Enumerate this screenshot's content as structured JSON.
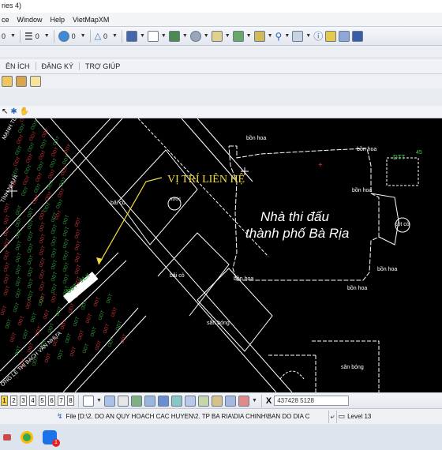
{
  "window": {
    "title_fragment": "ries 4)"
  },
  "menu": {
    "items": [
      "ce",
      "Window",
      "Help",
      "VietMapXM"
    ]
  },
  "toolbar1": {
    "counters": [
      "0",
      "0",
      "0",
      "0"
    ]
  },
  "tabs": {
    "items": [
      "ÊN ÍCH",
      "ĐĂNG KÝ",
      "TRỢ GIÚP"
    ]
  },
  "map": {
    "callout_text": "VỊ TRÍ LIÊN HỆ",
    "building_name_line1": "Nhà thi đấu",
    "building_name_line2": "thành phố Bà Rịa",
    "labels": {
      "bon_hoa": "bồn hoa",
      "bai_co": "bãi cỏ",
      "san_bong": "sân bóng",
      "cot_co": "cột cờ",
      "nuoc": "nước",
      "dtt": "DTT",
      "dtt_num": "45",
      "highlight_lot": "ODT - 91.X"
    },
    "streets": {
      "s1": "MẠNH TƯỜNG NHỰA",
      "s2": "TÍNH NHỰA",
      "s3": "ỜNG LÊ THỊ BẠCH VÂN NHỰA"
    },
    "lot_label": "ODT"
  },
  "bottom": {
    "pages": [
      "1",
      "2",
      "3",
      "4",
      "5",
      "6",
      "7",
      "8"
    ],
    "x_label": "X",
    "coordinate": "437428 5128"
  },
  "status": {
    "file_path": "File [D:\\2. DO AN QUY HOACH CAC HUYEN\\2. TP BA RIA\\DIA CHINH\\BAN DO DIA C",
    "level": "Level 13"
  },
  "taskbar": {
    "badge": "1"
  },
  "colors": {
    "map_bg": "#000000",
    "callout": "#f5dc3c",
    "lot_green": "#2f9e3a",
    "lot_red": "#d23232"
  }
}
